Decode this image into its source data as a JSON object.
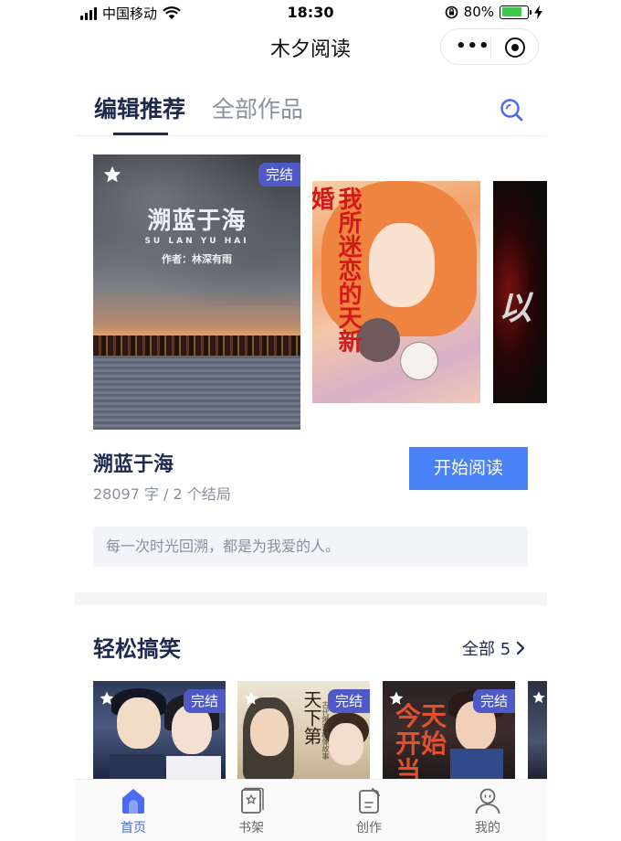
{
  "status_bar": {
    "carrier": "中国移动",
    "time": "18:30",
    "battery": "80%",
    "battery_level": 0.8
  },
  "app": {
    "title": "木夕阅读"
  },
  "tabs": [
    {
      "label": "编辑推荐",
      "active": true
    },
    {
      "label": "全部作品",
      "active": false
    }
  ],
  "featured": {
    "cover_title": "溯蓝于海",
    "cover_pinyin": "SU LAN YU HAI",
    "cover_author": "作者：林深有雨",
    "badge": "完结",
    "side_cover_1_title": "我所迷恋的天新婚",
    "side_cover_2_title": "以",
    "title": "溯蓝于海",
    "meta": "28097 字 / 2 个结局",
    "read_button": "开始阅读",
    "quote": "每一次时光回溯，都是为我爱的人。"
  },
  "section": {
    "title": "轻松搞笑",
    "more_label": "全部 5",
    "cards": [
      {
        "badge": "完结"
      },
      {
        "badge": "完结",
        "cover_title": "天下第",
        "cover_subtitle": "古代爆笑群像故事"
      },
      {
        "badge": "完结",
        "cover_title": "今天开始当"
      }
    ]
  },
  "tab_bar": [
    {
      "label": "首页",
      "icon": "home-icon",
      "active": true
    },
    {
      "label": "书架",
      "icon": "bookshelf-icon",
      "active": false
    },
    {
      "label": "创作",
      "icon": "write-icon",
      "active": false
    },
    {
      "label": "我的",
      "icon": "profile-icon",
      "active": false
    }
  ],
  "colors": {
    "accent": "#4a82f7",
    "badge": "#4f5ac7",
    "heading": "#1f2a4f",
    "tab_active": "#4a6cf0",
    "battery_fill": "#3cc94a"
  }
}
